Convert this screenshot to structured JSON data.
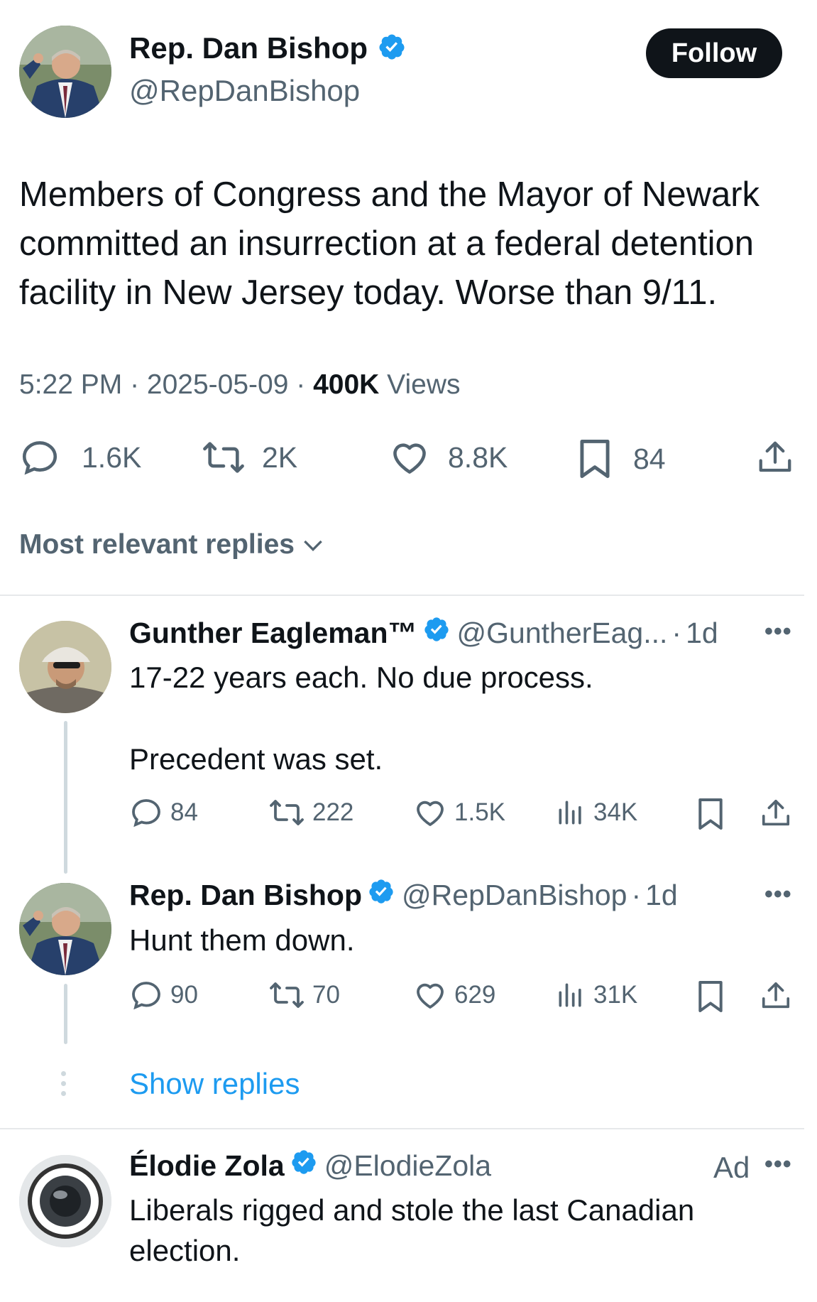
{
  "main_tweet": {
    "author_name": "Rep. Dan Bishop",
    "author_handle": "@RepDanBishop",
    "follow_label": "Follow",
    "text": "Members of Congress and the Mayor of Newark committed an insurrection at a federal detention facility in New Jersey today. Worse than 9/11.",
    "time": "5:22 PM",
    "date": "2025-05-09",
    "views_count": "400K",
    "views_label": "Views",
    "replies": "1.6K",
    "reposts": "2K",
    "likes": "8.8K",
    "bookmarks": "84"
  },
  "sort_label": "Most relevant replies",
  "replies": [
    {
      "author_name": "Gunther Eagleman™",
      "author_handle": "@GuntherEag...",
      "age": "1d",
      "line1": "17-22 years each.  No due process.",
      "line2": "Precedent was set.",
      "replies": "84",
      "reposts": "222",
      "likes": "1.5K",
      "views": "34K"
    },
    {
      "author_name": "Rep. Dan Bishop",
      "author_handle": "@RepDanBishop",
      "age": "1d",
      "line1": "Hunt them down.",
      "replies": "90",
      "reposts": "70",
      "likes": "629",
      "views": "31K"
    }
  ],
  "show_replies_label": "Show replies",
  "ad": {
    "author_name": "Élodie Zola",
    "author_handle": "@ElodieZola",
    "ad_label": "Ad",
    "line1": "Liberals rigged and stole the last Canadian",
    "line2": "election."
  },
  "colors": {
    "text": "#0f1419",
    "secondary": "#536471",
    "link": "#1d9bf0",
    "verified": "#1d9bf0"
  }
}
